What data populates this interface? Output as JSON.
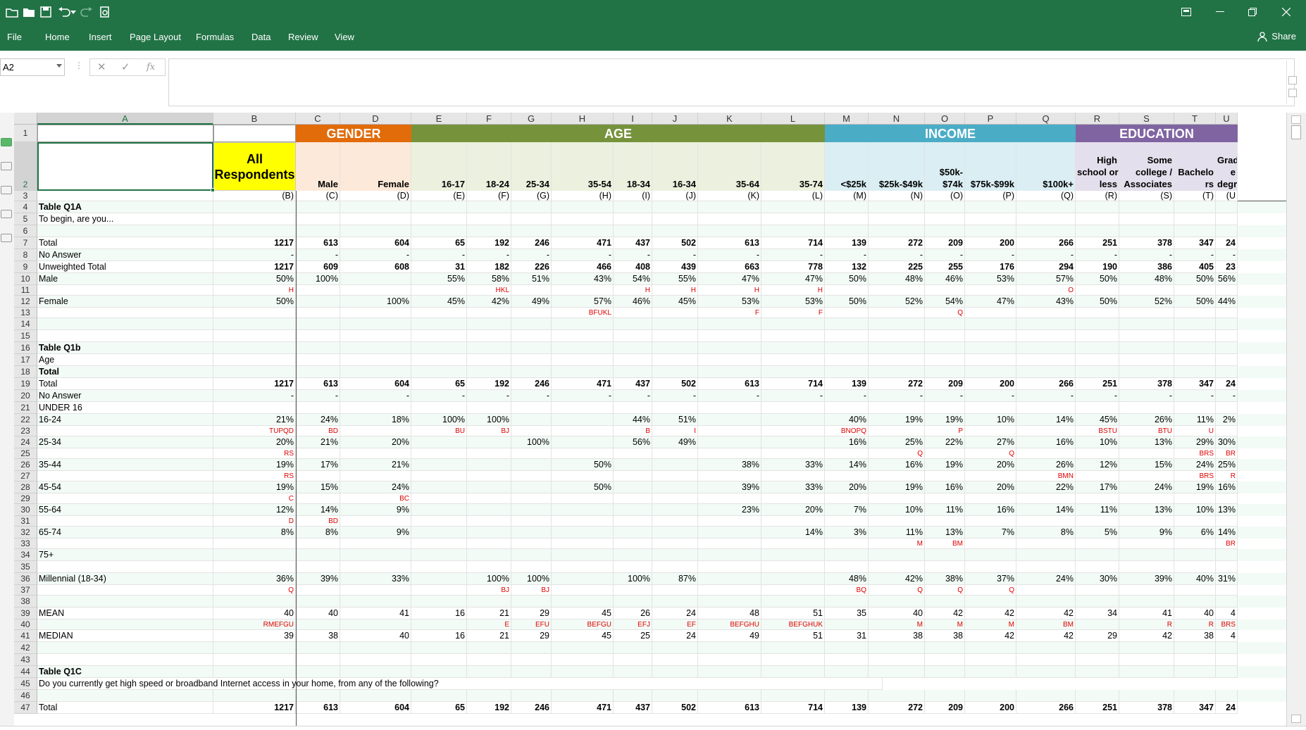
{
  "app": {
    "share_label": "Share",
    "menu": [
      "File",
      "Home",
      "Insert",
      "Page Layout",
      "Formulas",
      "Data",
      "Review",
      "View"
    ]
  },
  "formula_bar": {
    "name_box": "A2",
    "cancel_glyph": "✕",
    "enter_glyph": "✓",
    "fx_label": "fx",
    "value": ""
  },
  "columns": [
    {
      "letter": "A",
      "w": 250
    },
    {
      "letter": "B",
      "w": 117
    },
    {
      "letter": "C",
      "w": 63
    },
    {
      "letter": "D",
      "w": 101
    },
    {
      "letter": "E",
      "w": 79
    },
    {
      "letter": "F",
      "w": 63
    },
    {
      "letter": "G",
      "w": 57
    },
    {
      "letter": "H",
      "w": 88
    },
    {
      "letter": "I",
      "w": 55
    },
    {
      "letter": "J",
      "w": 65
    },
    {
      "letter": "K",
      "w": 90
    },
    {
      "letter": "L",
      "w": 90
    },
    {
      "letter": "M",
      "w": 62
    },
    {
      "letter": "N",
      "w": 80
    },
    {
      "letter": "O",
      "w": 57
    },
    {
      "letter": "P",
      "w": 73
    },
    {
      "letter": "Q",
      "w": 84
    },
    {
      "letter": "R",
      "w": 62
    },
    {
      "letter": "S",
      "w": 78
    },
    {
      "letter": "T",
      "w": 59
    },
    {
      "letter": "U",
      "w": 31
    }
  ],
  "bands": [
    {
      "label": "GENDER",
      "from": 2,
      "to": 3,
      "color": "#e26b0a",
      "sub_bg": "#fde9d9"
    },
    {
      "label": "AGE",
      "from": 4,
      "to": 11,
      "color": "#76933c",
      "sub_bg": "#ebf1de"
    },
    {
      "label": "INCOME",
      "from": 12,
      "to": 16,
      "color": "#4bacc6",
      "sub_bg": "#daeef3"
    },
    {
      "label": "EDUCATION",
      "from": 17,
      "to": 20,
      "color": "#8064a2",
      "sub_bg": "#e4dfec"
    }
  ],
  "all_respondents": [
    "All",
    "Respondents"
  ],
  "subheaders": [
    "",
    "",
    "Male",
    "Female",
    "16-17",
    "18-24",
    "25-34",
    "35-54",
    "18-34",
    "16-34",
    "35-64",
    "35-74",
    "<$25k",
    "$25k-$49k",
    "$50k-\n$74k",
    "$75k-$99k",
    "$100k+",
    "High\nschool or\nless",
    "Some\ncollege /\nAssociates",
    "Bachelo\nrs",
    "Gradua\ne\ndegree"
  ],
  "row3": [
    "",
    "(B)",
    "(C)",
    "(D)",
    "(E)",
    "(F)",
    "(G)",
    "(H)",
    "(I)",
    "(J)",
    "(K)",
    "(L)",
    "(M)",
    "(N)",
    "(O)",
    "(P)",
    "(Q)",
    "(R)",
    "(S)",
    "(T)",
    "(U"
  ],
  "rows": [
    {
      "n": 4,
      "a": "Table Q1A",
      "bold": true
    },
    {
      "n": 5,
      "a": "To begin, are you..."
    },
    {
      "n": 6,
      "a": ""
    },
    {
      "n": 7,
      "a": "Total",
      "v": [
        "1217",
        "613",
        "604",
        "65",
        "192",
        "246",
        "471",
        "437",
        "502",
        "613",
        "714",
        "139",
        "272",
        "209",
        "200",
        "266",
        "251",
        "378",
        "347",
        "24"
      ],
      "boldv": true
    },
    {
      "n": 8,
      "a": "No Answer",
      "v": [
        "-",
        "-",
        "-",
        "-",
        "-",
        "-",
        "-",
        "-",
        "-",
        "-",
        "-",
        "-",
        "-",
        "-",
        "-",
        "-",
        "-",
        "-",
        "-",
        "-"
      ]
    },
    {
      "n": 9,
      "a": "Unweighted Total",
      "v": [
        "1217",
        "609",
        "608",
        "31",
        "182",
        "226",
        "466",
        "408",
        "439",
        "663",
        "778",
        "132",
        "225",
        "255",
        "176",
        "294",
        "190",
        "386",
        "405",
        "23"
      ],
      "boldv": true
    },
    {
      "n": 10,
      "a": "Male",
      "v": [
        "50%",
        "100%",
        "",
        "55%",
        "58%",
        "51%",
        "43%",
        "54%",
        "55%",
        "47%",
        "47%",
        "50%",
        "48%",
        "46%",
        "53%",
        "57%",
        "50%",
        "48%",
        "50%",
        "56%"
      ]
    },
    {
      "n": 11,
      "a": "",
      "sig": true,
      "v": [
        "H",
        "",
        "",
        "",
        "HKL",
        "",
        "",
        "H",
        "H",
        "H",
        "H",
        "",
        "",
        "",
        "",
        "O",
        "",
        "",
        "",
        ""
      ]
    },
    {
      "n": 12,
      "a": "Female",
      "v": [
        "50%",
        "",
        "100%",
        "45%",
        "42%",
        "49%",
        "57%",
        "46%",
        "45%",
        "53%",
        "53%",
        "50%",
        "52%",
        "54%",
        "47%",
        "43%",
        "50%",
        "52%",
        "50%",
        "44%"
      ]
    },
    {
      "n": 13,
      "a": "",
      "sig": true,
      "v": [
        "",
        "",
        "",
        "",
        "",
        "",
        "BFUKL",
        "",
        "",
        "F",
        "F",
        "",
        "",
        "Q",
        "",
        "",
        "",
        "",
        "",
        ""
      ]
    },
    {
      "n": 14,
      "a": ""
    },
    {
      "n": 15,
      "a": ""
    },
    {
      "n": 16,
      "a": "Table Q1b",
      "bold": true
    },
    {
      "n": 17,
      "a": "Age"
    },
    {
      "n": 18,
      "a": "Total",
      "bold": true
    },
    {
      "n": 19,
      "a": "Total",
      "v": [
        "1217",
        "613",
        "604",
        "65",
        "192",
        "246",
        "471",
        "437",
        "502",
        "613",
        "714",
        "139",
        "272",
        "209",
        "200",
        "266",
        "251",
        "378",
        "347",
        "24"
      ],
      "boldv": true
    },
    {
      "n": 20,
      "a": "No Answer",
      "v": [
        "-",
        "-",
        "-",
        "-",
        "-",
        "-",
        "-",
        "-",
        "-",
        "-",
        "-",
        "-",
        "-",
        "-",
        "-",
        "-",
        "-",
        "-",
        "-",
        "-"
      ]
    },
    {
      "n": 21,
      "a": "UNDER 16",
      "v": [
        "",
        "",
        "",
        "",
        "",
        "",
        "",
        "",
        "",
        "",
        "",
        "",
        "",
        "",
        "",
        "",
        "",
        "",
        "",
        ""
      ]
    },
    {
      "n": 22,
      "a": "16-24",
      "v": [
        "21%",
        "24%",
        "18%",
        "100%",
        "100%",
        "",
        "",
        "44%",
        "51%",
        "",
        "",
        "40%",
        "19%",
        "19%",
        "10%",
        "14%",
        "45%",
        "26%",
        "11%",
        "2%"
      ]
    },
    {
      "n": 23,
      "a": "",
      "sig": true,
      "v": [
        "TUPQD",
        "BD",
        "",
        "BU",
        "BJ",
        "",
        "",
        "B",
        "I",
        "",
        "",
        "BNOPQ",
        "",
        "P",
        "",
        "",
        "BSTU",
        "BTU",
        "U",
        ""
      ]
    },
    {
      "n": 24,
      "a": "25-34",
      "v": [
        "20%",
        "21%",
        "20%",
        "",
        "",
        "100%",
        "",
        "56%",
        "49%",
        "",
        "",
        "16%",
        "25%",
        "22%",
        "27%",
        "16%",
        "10%",
        "13%",
        "29%",
        "30%"
      ]
    },
    {
      "n": 25,
      "a": "",
      "sig": true,
      "v": [
        "RS",
        "",
        "",
        "",
        "",
        "",
        "",
        "",
        "",
        "",
        "",
        "",
        "Q",
        "",
        "Q",
        "",
        "",
        "",
        "BRS",
        "BR"
      ]
    },
    {
      "n": 26,
      "a": "35-44",
      "v": [
        "19%",
        "17%",
        "21%",
        "",
        "",
        "",
        "50%",
        "",
        "",
        "38%",
        "33%",
        "14%",
        "16%",
        "19%",
        "20%",
        "26%",
        "12%",
        "15%",
        "24%",
        "25%"
      ]
    },
    {
      "n": 27,
      "a": "",
      "sig": true,
      "v": [
        "RS",
        "",
        "",
        "",
        "",
        "",
        "",
        "",
        "",
        "",
        "",
        "",
        "",
        "",
        "",
        "BMN",
        "",
        "",
        "BRS",
        "R"
      ]
    },
    {
      "n": 28,
      "a": "45-54",
      "v": [
        "19%",
        "15%",
        "24%",
        "",
        "",
        "",
        "50%",
        "",
        "",
        "39%",
        "33%",
        "20%",
        "19%",
        "16%",
        "20%",
        "22%",
        "17%",
        "24%",
        "19%",
        "16%"
      ]
    },
    {
      "n": 29,
      "a": "",
      "sig": true,
      "v": [
        "C",
        "",
        "BC",
        "",
        "",
        "",
        "",
        "",
        "",
        "",
        "",
        "",
        "",
        "",
        "",
        "",
        "",
        "",
        "",
        ""
      ]
    },
    {
      "n": 30,
      "a": "55-64",
      "v": [
        "12%",
        "14%",
        "9%",
        "",
        "",
        "",
        "",
        "",
        "",
        "23%",
        "20%",
        "7%",
        "10%",
        "11%",
        "16%",
        "14%",
        "11%",
        "13%",
        "10%",
        "13%"
      ]
    },
    {
      "n": 31,
      "a": "",
      "sig": true,
      "v": [
        "D",
        "BD",
        "",
        "",
        "",
        "",
        "",
        "",
        "",
        "",
        "",
        "",
        "",
        "",
        "",
        "",
        "",
        "",
        "",
        ""
      ]
    },
    {
      "n": 32,
      "a": "65-74",
      "v": [
        "8%",
        "8%",
        "9%",
        "",
        "",
        "",
        "",
        "",
        "",
        "",
        "14%",
        "3%",
        "11%",
        "13%",
        "7%",
        "8%",
        "5%",
        "9%",
        "6%",
        "14%"
      ]
    },
    {
      "n": 33,
      "a": "",
      "sig": true,
      "v": [
        "",
        "",
        "",
        "",
        "",
        "",
        "",
        "",
        "",
        "",
        "",
        "",
        "M",
        "BM",
        "",
        "",
        "",
        "",
        "",
        "BR"
      ]
    },
    {
      "n": 34,
      "a": "75+"
    },
    {
      "n": 35,
      "a": ""
    },
    {
      "n": 36,
      "a": "Millennial (18-34)",
      "v": [
        "36%",
        "39%",
        "33%",
        "",
        "100%",
        "100%",
        "",
        "100%",
        "87%",
        "",
        "",
        "48%",
        "42%",
        "38%",
        "37%",
        "24%",
        "30%",
        "39%",
        "40%",
        "31%"
      ]
    },
    {
      "n": 37,
      "a": "",
      "sig": true,
      "v": [
        "Q",
        "",
        "",
        "",
        "BJ",
        "BJ",
        "",
        "",
        "",
        "",
        "",
        "BQ",
        "Q",
        "Q",
        "Q",
        "",
        "",
        "",
        "",
        ""
      ]
    },
    {
      "n": 38,
      "a": ""
    },
    {
      "n": 39,
      "a": "MEAN",
      "v": [
        "40",
        "40",
        "41",
        "16",
        "21",
        "29",
        "45",
        "26",
        "24",
        "48",
        "51",
        "35",
        "40",
        "42",
        "42",
        "42",
        "34",
        "41",
        "40",
        "4"
      ]
    },
    {
      "n": 40,
      "a": "",
      "sig": true,
      "v": [
        "RMEFGU",
        "",
        "",
        "",
        "E",
        "EFU",
        "BEFGU",
        "EFJ",
        "EF",
        "BEFGHU",
        "BEFGHUK",
        "",
        "M",
        "M",
        "M",
        "BM",
        "",
        "R",
        "R",
        "BRS"
      ]
    },
    {
      "n": 41,
      "a": "MEDIAN",
      "v": [
        "39",
        "38",
        "40",
        "16",
        "21",
        "29",
        "45",
        "25",
        "24",
        "49",
        "51",
        "31",
        "38",
        "38",
        "42",
        "42",
        "29",
        "42",
        "38",
        "4"
      ]
    },
    {
      "n": 42,
      "a": ""
    },
    {
      "n": 43,
      "a": ""
    },
    {
      "n": 44,
      "a": "Table Q1C",
      "bold": true
    },
    {
      "n": 45,
      "a": "Do you currently get high speed or broadband Internet access in your home, from any of the following?",
      "overflow": true
    },
    {
      "n": 46,
      "a": ""
    },
    {
      "n": 47,
      "a": "Total",
      "v": [
        "1217",
        "613",
        "604",
        "65",
        "192",
        "246",
        "471",
        "437",
        "502",
        "613",
        "714",
        "139",
        "272",
        "209",
        "200",
        "266",
        "251",
        "378",
        "347",
        "24"
      ],
      "boldv": true
    }
  ],
  "colors": {
    "green": "#217346",
    "row_tint": "#f2fbf6",
    "yellow": "#ffff00",
    "sig_red": "#e00000"
  }
}
